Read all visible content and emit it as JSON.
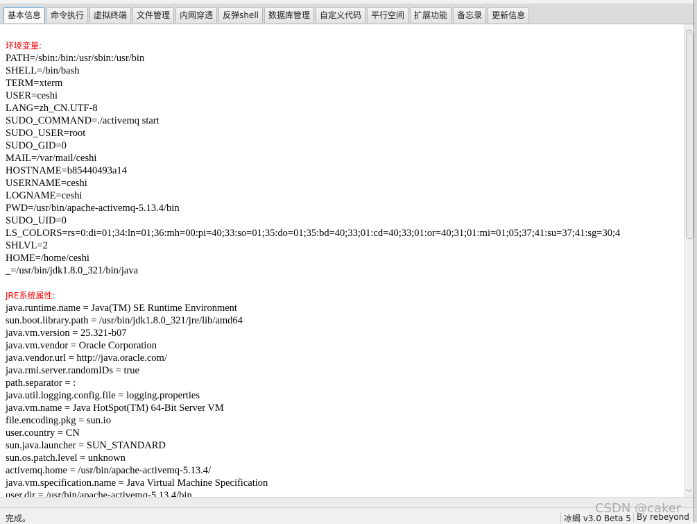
{
  "tabs": [
    "基本信息",
    "命令执行",
    "虚拟终端",
    "文件管理",
    "内网穿透",
    "反弹shell",
    "数据库管理",
    "自定义代码",
    "平行空间",
    "扩展功能",
    "备忘录",
    "更新信息"
  ],
  "active_tab": "基本信息",
  "env_section": {
    "title": "环境变量:",
    "lines": [
      "PATH=/sbin:/bin:/usr/sbin:/usr/bin",
      "SHELL=/bin/bash",
      "TERM=xterm",
      "USER=ceshi",
      "LANG=zh_CN.UTF-8",
      "SUDO_COMMAND=./activemq start",
      "SUDO_USER=root",
      "SUDO_GID=0",
      "MAIL=/var/mail/ceshi",
      "HOSTNAME=b85440493a14",
      "USERNAME=ceshi",
      "LOGNAME=ceshi",
      "PWD=/usr/bin/apache-activemq-5.13.4/bin",
      "SUDO_UID=0",
      "LS_COLORS=rs=0:di=01;34:ln=01;36:mh=00:pi=40;33:so=01;35:do=01;35:bd=40;33;01:cd=40;33;01:or=40;31;01:mi=01;05;37;41:su=37;41:sg=30;4",
      "SHLVL=2",
      "HOME=/home/ceshi",
      "_=/usr/bin/jdk1.8.0_321/bin/java"
    ]
  },
  "jre_section": {
    "title": "JRE系统属性:",
    "lines": [
      "java.runtime.name = Java(TM) SE Runtime Environment",
      "sun.boot.library.path = /usr/bin/jdk1.8.0_321/jre/lib/amd64",
      "java.vm.version = 25.321-b07",
      "java.vm.vendor = Oracle Corporation",
      "java.vendor.url = http://java.oracle.com/",
      "java.rmi.server.randomIDs = true",
      "path.separator = :",
      "java.util.logging.config.file = logging.properties",
      "java.vm.name = Java HotSpot(TM) 64-Bit Server VM",
      "file.encoding.pkg = sun.io",
      "user.country = CN",
      "sun.java.launcher = SUN_STANDARD",
      "sun.os.patch.level = unknown",
      "activemq.home = /usr/bin/apache-activemq-5.13.4/",
      "java.vm.specification.name = Java Virtual Machine Specification",
      "user.dir = /usr/bin/apache-activemq-5.13.4/bin"
    ]
  },
  "status": {
    "message": "完成。",
    "version": "冰蝎 v3.0 Beta 5",
    "author": "By rebeyond"
  },
  "watermark": "CSDN @caker",
  "colors": {
    "section_title": "#ee0000",
    "active_tab_border": "#5aa0d8"
  }
}
